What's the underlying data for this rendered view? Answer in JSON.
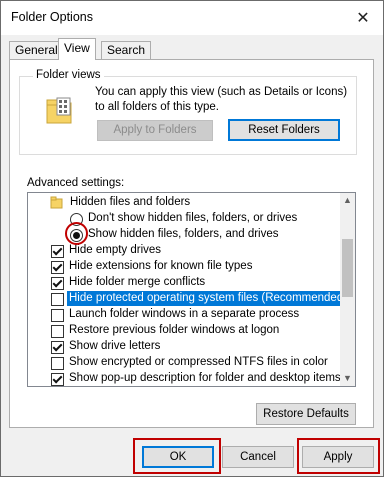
{
  "window": {
    "title": "Folder Options",
    "close_glyph": "✕"
  },
  "tabs": [
    {
      "label": "General",
      "active": false
    },
    {
      "label": "View",
      "active": true
    },
    {
      "label": "Search",
      "active": false
    }
  ],
  "folder_views": {
    "group_label": "Folder views",
    "description": "You can apply this view (such as Details or Icons) to all folders of this type.",
    "apply_to_folders_label": "Apply to Folders",
    "reset_folders_label": "Reset Folders"
  },
  "advanced": {
    "label": "Advanced settings:",
    "items": [
      {
        "type": "folder",
        "label": "Hidden files and folders"
      },
      {
        "type": "radio",
        "checked": false,
        "label": "Don't show hidden files, folders, or drives"
      },
      {
        "type": "radio",
        "checked": true,
        "label": "Show hidden files, folders, and drives"
      },
      {
        "type": "checkbox",
        "checked": true,
        "label": "Hide empty drives"
      },
      {
        "type": "checkbox",
        "checked": true,
        "label": "Hide extensions for known file types"
      },
      {
        "type": "checkbox",
        "checked": true,
        "label": "Hide folder merge conflicts"
      },
      {
        "type": "checkbox",
        "checked": false,
        "selected": true,
        "label": "Hide protected operating system files (Recommended)"
      },
      {
        "type": "checkbox",
        "checked": false,
        "label": "Launch folder windows in a separate process"
      },
      {
        "type": "checkbox",
        "checked": false,
        "label": "Restore previous folder windows at logon"
      },
      {
        "type": "checkbox",
        "checked": true,
        "label": "Show drive letters"
      },
      {
        "type": "checkbox",
        "checked": false,
        "label": "Show encrypted or compressed NTFS files in color"
      },
      {
        "type": "checkbox",
        "checked": true,
        "label": "Show pop-up description for folder and desktop items"
      }
    ]
  },
  "restore_defaults_label": "Restore Defaults",
  "footer": {
    "ok_label": "OK",
    "cancel_label": "Cancel",
    "apply_label": "Apply"
  },
  "colors": {
    "selection": "#0078d7",
    "highlight_red": "#c00000"
  }
}
